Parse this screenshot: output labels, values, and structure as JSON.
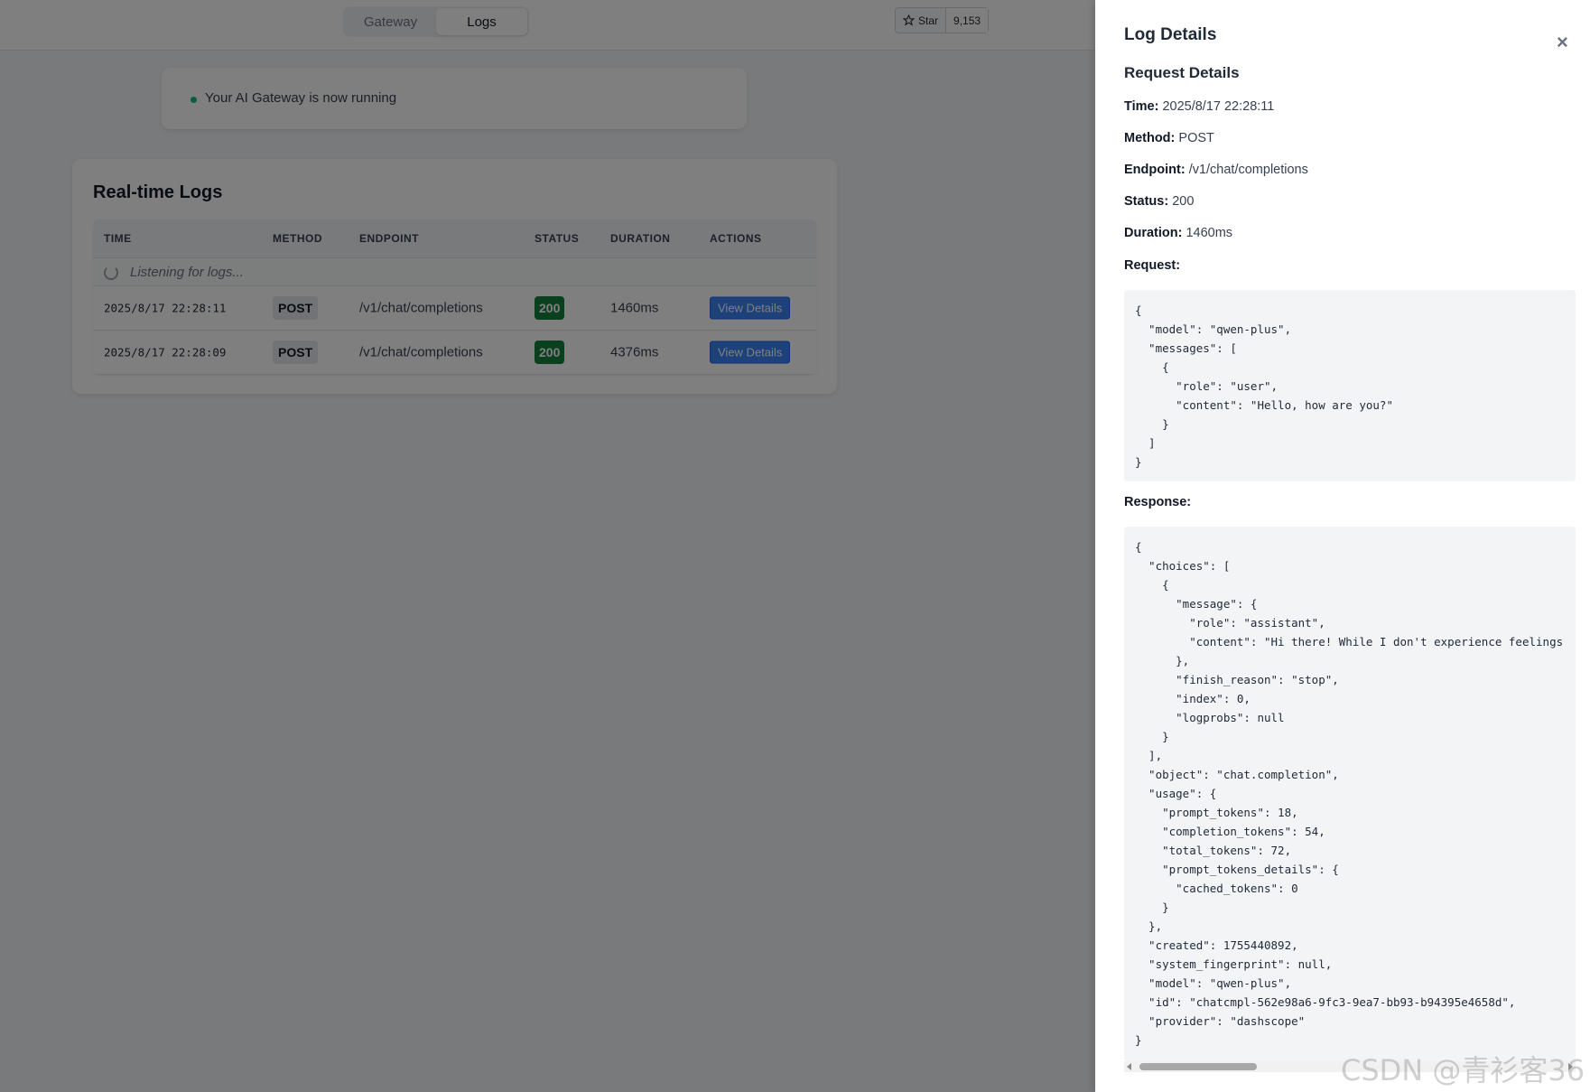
{
  "nav": {
    "tabs": [
      {
        "label": "Gateway",
        "active": false
      },
      {
        "label": "Logs",
        "active": true
      }
    ],
    "star_label": "Star",
    "star_count": "9,153"
  },
  "status": {
    "message": "Your AI Gateway is now running",
    "dot_color": "#10b981"
  },
  "logs": {
    "title": "Real-time Logs",
    "columns": [
      "TIME",
      "METHOD",
      "ENDPOINT",
      "STATUS",
      "DURATION",
      "ACTIONS"
    ],
    "listening": "Listening for logs...",
    "rows": [
      {
        "time": "2025/8/17 22:28:11",
        "method": "POST",
        "endpoint": "/v1/chat/completions",
        "status": "200",
        "duration": "1460ms",
        "action": "View Details"
      },
      {
        "time": "2025/8/17 22:28:09",
        "method": "POST",
        "endpoint": "/v1/chat/completions",
        "status": "200",
        "duration": "4376ms",
        "action": "View Details"
      }
    ]
  },
  "panel": {
    "title": "Log Details",
    "close": "×",
    "subtitle": "Request Details",
    "time_label": "Time:",
    "time_value": "2025/8/17 22:28:11",
    "method_label": "Method:",
    "method_value": "POST",
    "endpoint_label": "Endpoint:",
    "endpoint_value": "/v1/chat/completions",
    "status_label": "Status:",
    "status_value": "200",
    "duration_label": "Duration:",
    "duration_value": "1460ms",
    "request_label": "Request:",
    "request_body": "{\n  \"model\": \"qwen-plus\",\n  \"messages\": [\n    {\n      \"role\": \"user\",\n      \"content\": \"Hello, how are you?\"\n    }\n  ]\n}",
    "response_label": "Response:",
    "response_body": "{\n  \"choices\": [\n    {\n      \"message\": {\n        \"role\": \"assistant\",\n        \"content\": \"Hi there! While I don't experience feelings\n      },\n      \"finish_reason\": \"stop\",\n      \"index\": 0,\n      \"logprobs\": null\n    }\n  ],\n  \"object\": \"chat.completion\",\n  \"usage\": {\n    \"prompt_tokens\": 18,\n    \"completion_tokens\": 54,\n    \"total_tokens\": 72,\n    \"prompt_tokens_details\": {\n      \"cached_tokens\": 0\n    }\n  },\n  \"created\": 1755440892,\n  \"system_fingerprint\": null,\n  \"model\": \"qwen-plus\",\n  \"id\": \"chatcmpl-562e98a6-9fc3-9ea7-bb93-b94395e4658d\",\n  \"provider\": \"dashscope\"\n}"
  },
  "watermark": "CSDN @青衫客36"
}
